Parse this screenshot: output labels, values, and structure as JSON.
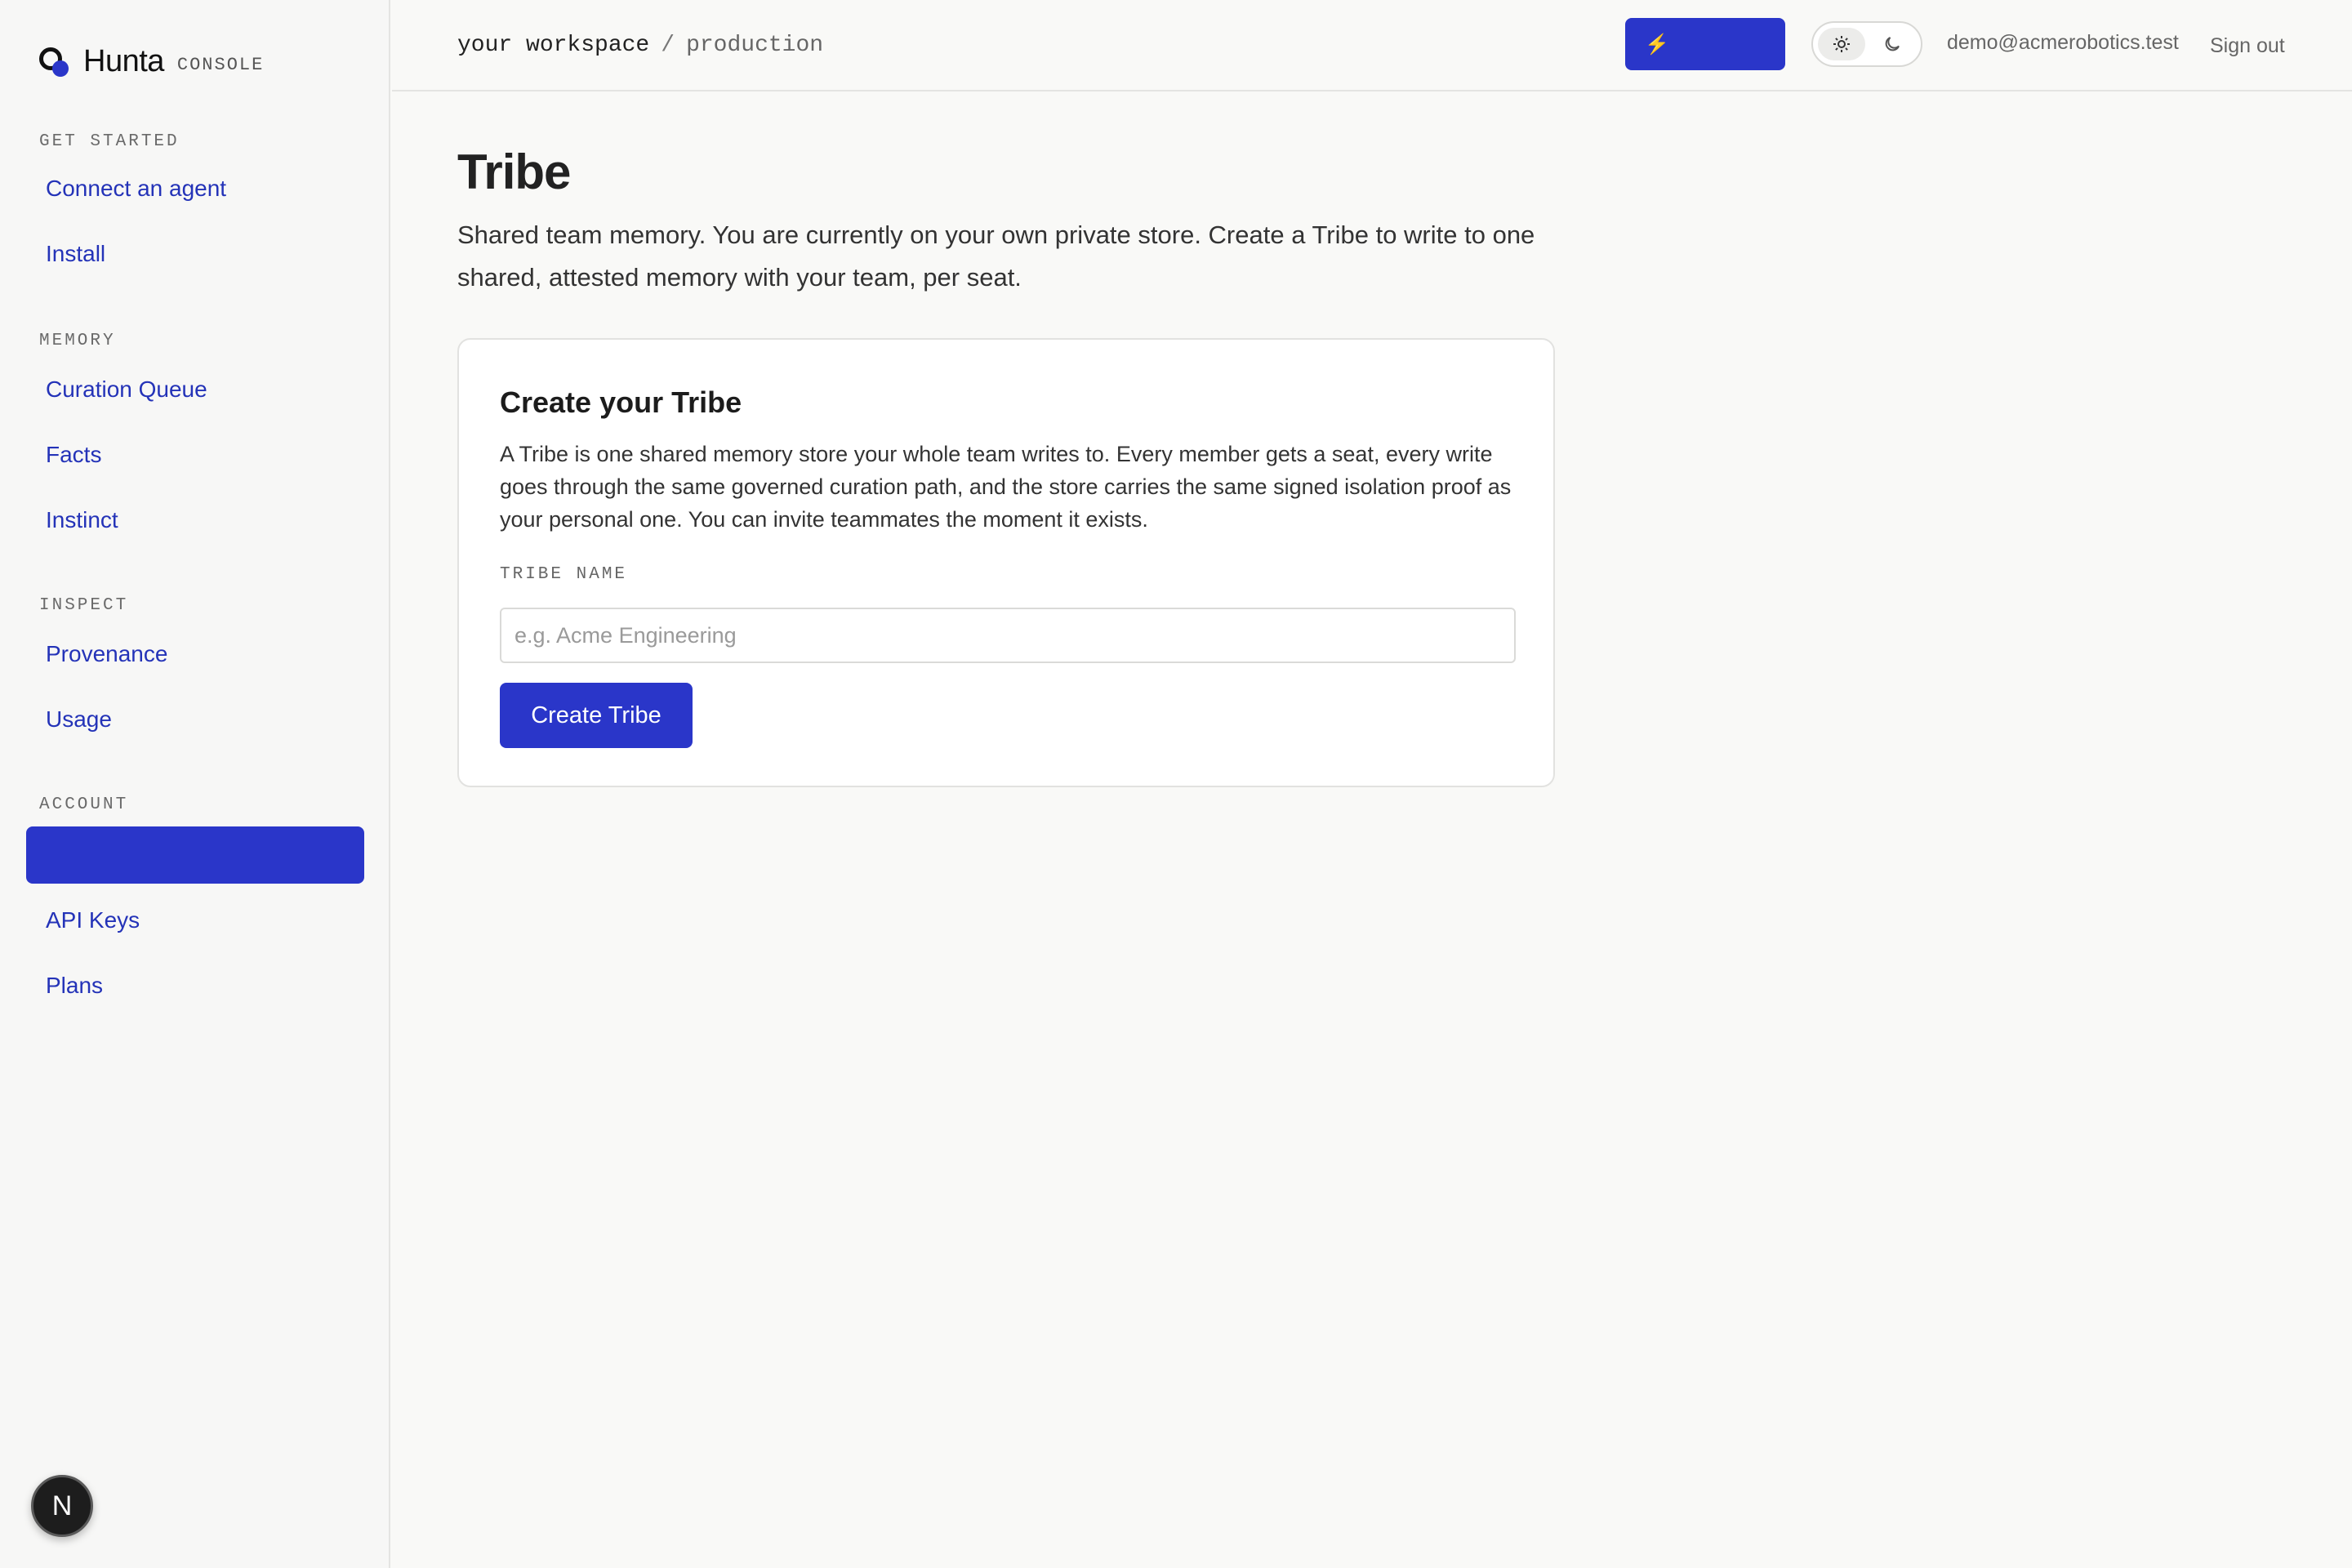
{
  "sidebar": {
    "brand_name": "Hunta",
    "brand_sub": "CONSOLE",
    "sections": {
      "get_started": "GET STARTED",
      "memory": "MEMORY",
      "inspect": "INSPECT",
      "account": "ACCOUNT"
    },
    "items": {
      "connect_agent": "Connect an agent",
      "install": "Install",
      "curation_queue": "Curation Queue",
      "facts": "Facts",
      "instinct": "Instinct",
      "provenance": "Provenance",
      "usage": "Usage",
      "tribe_active": "",
      "api_keys": "API Keys",
      "plans": "Plans"
    },
    "badge_letter": "N"
  },
  "header": {
    "workspace": "your workspace",
    "separator": "/",
    "environment": "production",
    "bolt_icon": "⚡",
    "theme_light_icon": "sun-icon",
    "theme_dark_icon": "moon-icon",
    "user_email": "demo@acmerobotics.test",
    "sign_out": "Sign out"
  },
  "main": {
    "title": "Tribe",
    "description": "Shared team memory. You are currently on your own private store. Create a Tribe to write to one shared, attested memory with your team, per seat.",
    "card": {
      "title": "Create your Tribe",
      "description": "A Tribe is one shared memory store your whole team writes to. Every member gets a seat, every write goes through the same governed curation path, and the store carries the same signed isolation proof as your personal one. You can invite teammates the moment it exists.",
      "field_label": "TRIBE NAME",
      "input_value": "",
      "input_placeholder": "e.g. Acme Engineering",
      "submit_label": "Create Tribe"
    }
  },
  "colors": {
    "accent": "#2a36c9",
    "link": "#2433b8",
    "background": "#f9f9f7"
  }
}
